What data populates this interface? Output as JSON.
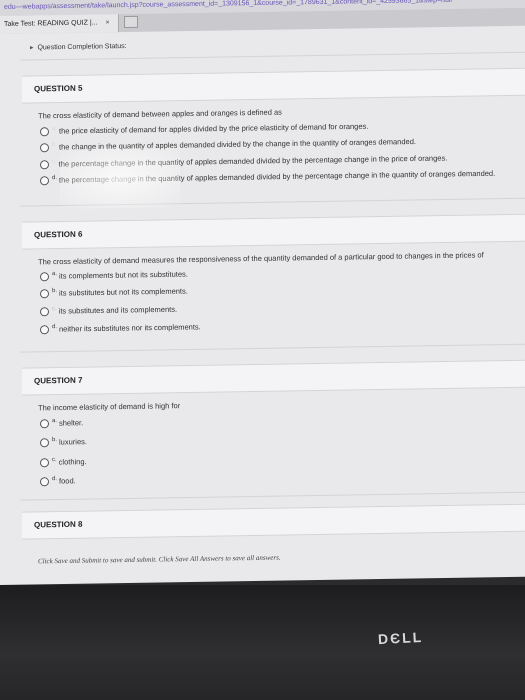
{
  "browser": {
    "url": "edu—webapps/assessment/take/launch.jsp?course_assessment_id=_1309156_1&course_id=_1789631_1&content_id=_42593665_1&step=null",
    "tab_title": "Take Test: READING QUIZ |...",
    "tab_close": "×"
  },
  "status_toggle": "Question Completion Status:",
  "questions": [
    {
      "title": "QUESTION 5",
      "stem": "The cross elasticity of demand between apples and oranges is defined as",
      "options": [
        {
          "letter": "a.",
          "text": "the price elasticity of demand for apples divided by the price elasticity of demand for oranges."
        },
        {
          "letter": "b.",
          "text": "the change in the quantity of apples demanded divided by the change in the quantity of oranges demanded."
        },
        {
          "letter": "c.",
          "text": "the percentage change in the quantity of apples demanded divided by the percentage change in the price of oranges."
        },
        {
          "letter": "d.",
          "text": "the percentage change in the quantity of apples demanded divided by the percentage change in the quantity of oranges demanded."
        }
      ]
    },
    {
      "title": "QUESTION 6",
      "stem": "The cross elasticity of demand measures the responsiveness of the quantity demanded of a particular good to changes in the prices of",
      "options": [
        {
          "letter": "a.",
          "text": "its complements but not its substitutes."
        },
        {
          "letter": "b.",
          "text": "its substitutes but not its complements."
        },
        {
          "letter": "c.",
          "text": "its substitutes and its complements."
        },
        {
          "letter": "d.",
          "text": "neither its substitutes nor its complements."
        }
      ]
    },
    {
      "title": "QUESTION 7",
      "stem": "The income elasticity of demand is high for",
      "options": [
        {
          "letter": "a.",
          "text": "shelter."
        },
        {
          "letter": "b.",
          "text": "luxuries."
        },
        {
          "letter": "c.",
          "text": "clothing."
        },
        {
          "letter": "d.",
          "text": "food."
        }
      ]
    },
    {
      "title": "QUESTION 8",
      "stem": "",
      "options": []
    }
  ],
  "footer": "Click Save and Submit to save and submit. Click Save All Answers to save all answers.",
  "bezel_logo": "DЄLL"
}
